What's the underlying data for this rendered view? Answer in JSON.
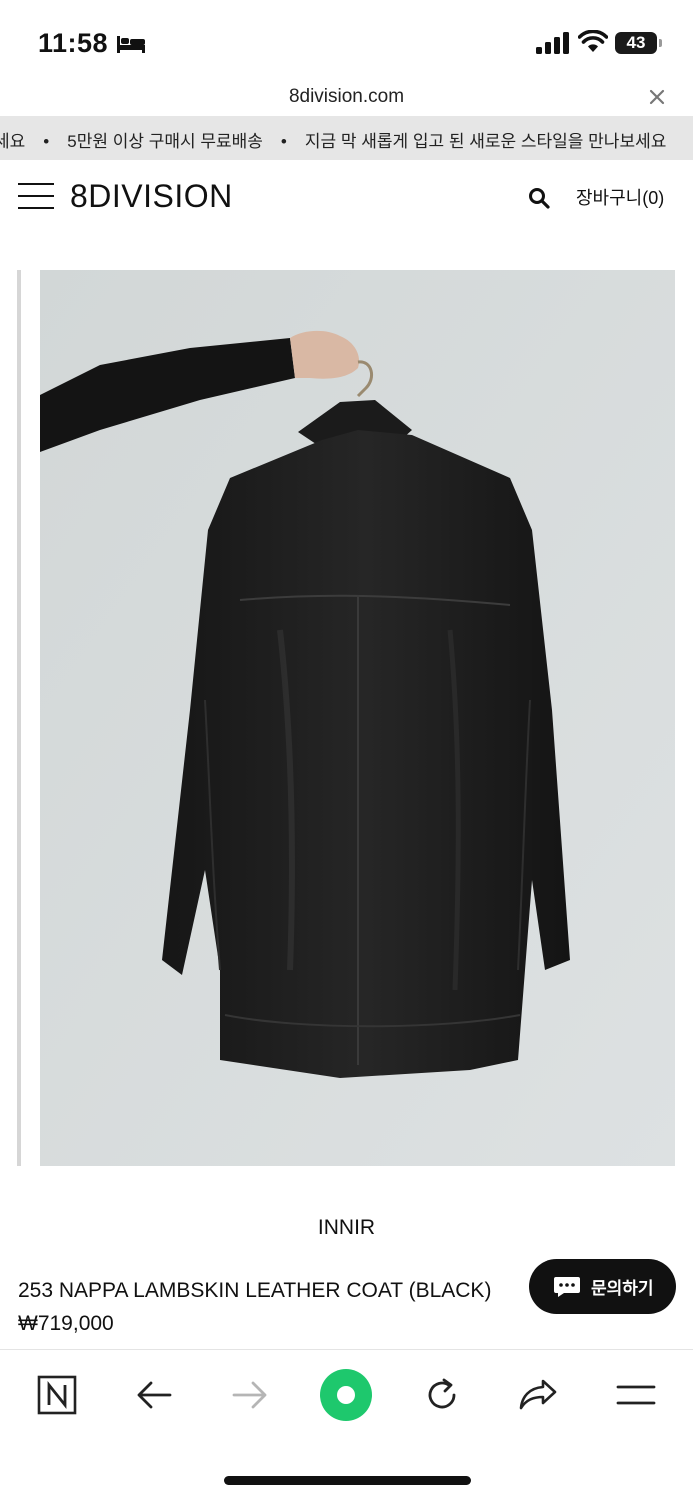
{
  "status_bar": {
    "time": "11:58",
    "battery": "43",
    "icons": [
      "bed-icon",
      "signal-icon",
      "wifi-icon",
      "battery-icon"
    ]
  },
  "browser": {
    "url": "8division.com",
    "close_icon": "close-icon"
  },
  "announcement": {
    "items": [
      "세요",
      "5만원 이상 구매시 무료배송",
      "지금 막 새롭게 입고 된 새로운 스타일을 만나보세요"
    ],
    "separator": "•"
  },
  "header": {
    "logo": "8DIVISION",
    "menu_icon": "hamburger-icon",
    "search_icon": "search-icon",
    "cart_label": "장바구니(0)"
  },
  "product": {
    "brand": "INNIR",
    "name": "253 NAPPA LAMBSKIN LEATHER COAT (BLACK)",
    "price": "₩719,000",
    "inquiry_label": "문의하기"
  },
  "toolbar": {
    "items": [
      "naver-n-icon",
      "back-arrow-icon",
      "forward-arrow-icon",
      "green-circle-icon",
      "refresh-icon",
      "share-icon",
      "menu-icon"
    ]
  },
  "colors": {
    "accent_green": "#1ec86d",
    "marquee_bg": "#e6e6e6",
    "image_bg": "#d7dcdc"
  }
}
